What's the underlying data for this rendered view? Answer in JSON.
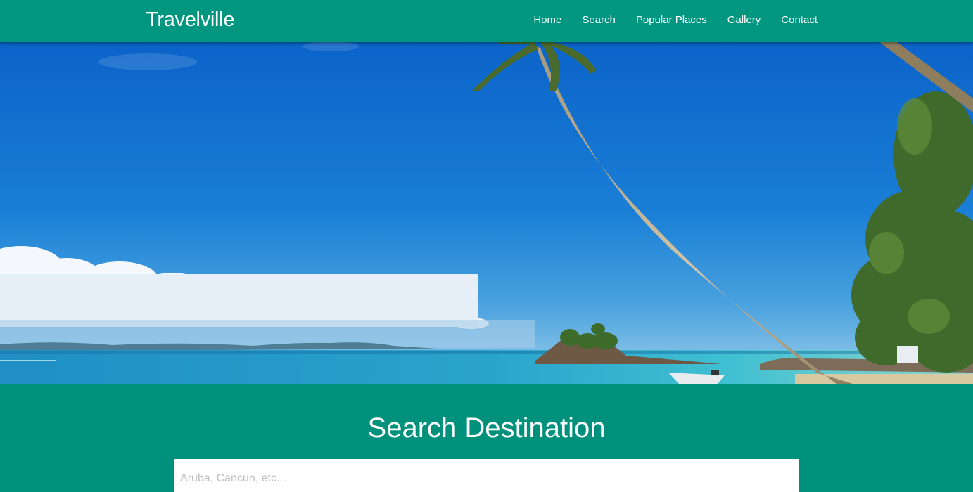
{
  "brand": {
    "name": "Travelville"
  },
  "nav": {
    "items": [
      {
        "label": "Home"
      },
      {
        "label": "Search"
      },
      {
        "label": "Popular Places"
      },
      {
        "label": "Gallery"
      },
      {
        "label": "Contact"
      }
    ]
  },
  "search": {
    "title": "Search Destination",
    "placeholder": "Aruba, Cancun, etc...",
    "value": ""
  },
  "colors": {
    "brand_green": "#00967f",
    "section_green": "#00917c",
    "sky_blue": "#1677d2",
    "sea_turquoise": "#2ea9c9"
  }
}
